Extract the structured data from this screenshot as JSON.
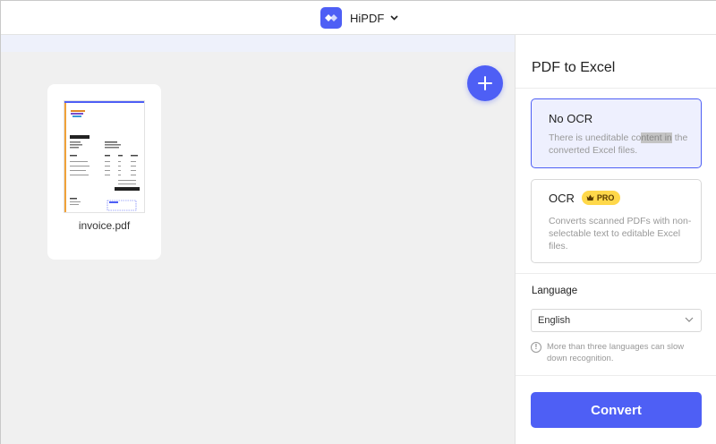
{
  "header": {
    "app_name": "HiPDF",
    "logo_icon": "hipdf-logo-icon",
    "menu_icon": "chevron-down-icon"
  },
  "workspace": {
    "file": {
      "name": "invoice.pdf",
      "thumbnail": "invoice-thumbnail"
    },
    "add_button_icon": "plus-icon"
  },
  "panel": {
    "title": "PDF to Excel",
    "options": [
      {
        "title": "No OCR",
        "desc_before": "There is uneditable co",
        "desc_highlight": "ntent in",
        "desc_after": " the converted Excel files.",
        "selected": true
      },
      {
        "title": "OCR",
        "badge": "PRO",
        "badge_icon": "crown-icon",
        "description": "Converts scanned PDFs with non-selectable text to editable Excel files.",
        "selected": false
      }
    ],
    "language": {
      "label": "Language",
      "selected": "English",
      "note": "More than three languages can slow down recognition.",
      "note_icon": "info-icon"
    },
    "convert_label": "Convert"
  },
  "colors": {
    "accent": "#4e5ff5",
    "selected_bg": "#eef0fe",
    "pro_badge": "#ffd84a",
    "workspace_bg": "#f0f0f0"
  }
}
